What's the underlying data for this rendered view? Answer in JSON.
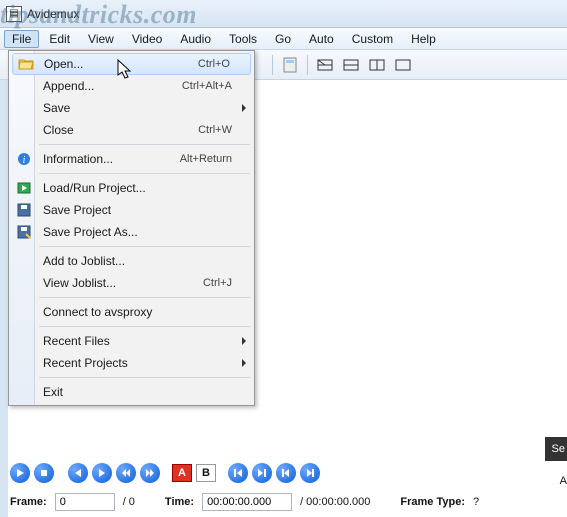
{
  "watermark": "tipsandtricks.com",
  "window": {
    "title": "Avidemux"
  },
  "menubar": [
    "File",
    "Edit",
    "View",
    "Video",
    "Audio",
    "Tools",
    "Go",
    "Auto",
    "Custom",
    "Help"
  ],
  "fileMenu": {
    "open": {
      "label": "Open...",
      "shortcut": "Ctrl+O"
    },
    "append": {
      "label": "Append...",
      "shortcut": "Ctrl+Alt+A"
    },
    "save": {
      "label": "Save"
    },
    "close": {
      "label": "Close",
      "shortcut": "Ctrl+W"
    },
    "info": {
      "label": "Information...",
      "shortcut": "Alt+Return"
    },
    "loadrun": {
      "label": "Load/Run Project..."
    },
    "saveproj": {
      "label": "Save Project"
    },
    "saveprojas": {
      "label": "Save Project As..."
    },
    "addjob": {
      "label": "Add to Joblist..."
    },
    "viewjob": {
      "label": "View Joblist...",
      "shortcut": "Ctrl+J"
    },
    "avsproxy": {
      "label": "Connect to avsproxy"
    },
    "recentfiles": {
      "label": "Recent Files"
    },
    "recentproj": {
      "label": "Recent Projects"
    },
    "exit": {
      "label": "Exit"
    }
  },
  "markers": {
    "a": "A",
    "b": "B"
  },
  "bottomDark": "Se",
  "bottomA": "A",
  "status": {
    "frameLabel": "Frame:",
    "frameValue": "0",
    "frameTotal": "/ 0",
    "timeLabel": "Time:",
    "timeValue": "00:00:00.000",
    "timeTotal": "/ 00:00:00.000",
    "frameTypeLabel": "Frame Type:",
    "frameTypeValue": "?"
  }
}
